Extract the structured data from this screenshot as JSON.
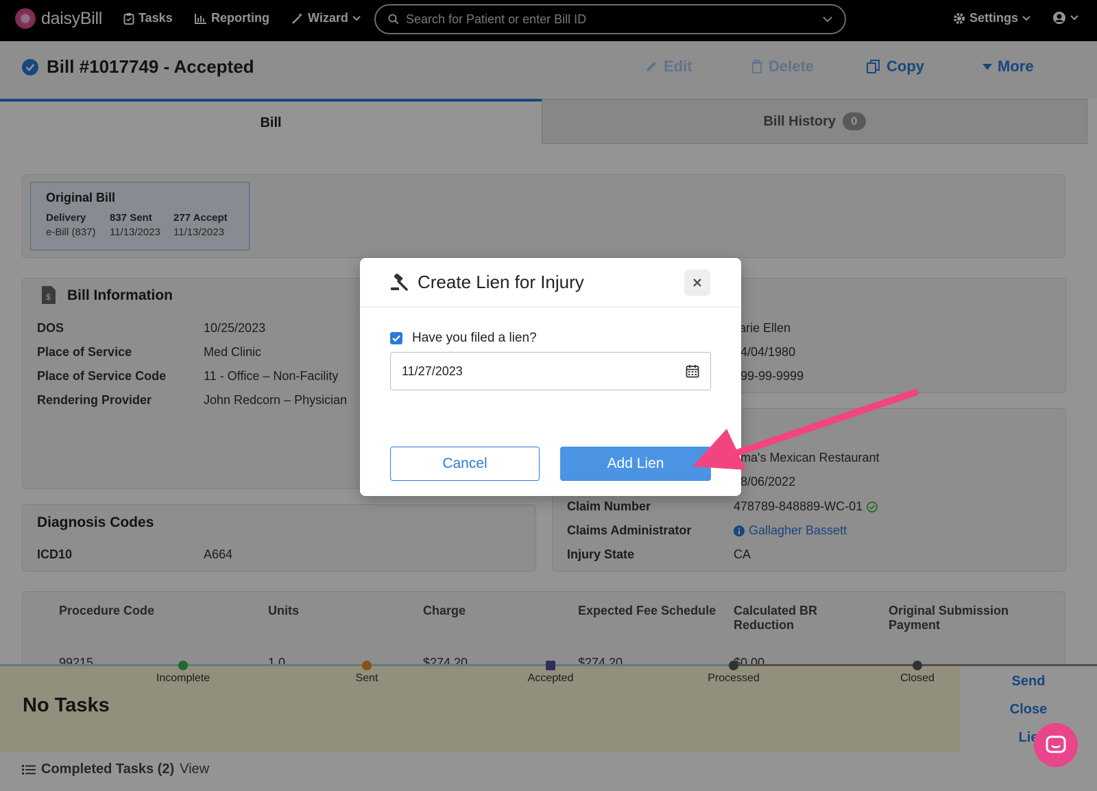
{
  "nav": {
    "brand": "daisyBill",
    "tasks": "Tasks",
    "reporting": "Reporting",
    "wizard": "Wizard",
    "search_placeholder": "Search for Patient or enter Bill ID",
    "settings": "Settings"
  },
  "header": {
    "title": "Bill #1017749 - Accepted",
    "edit": "Edit",
    "delete": "Delete",
    "copy": "Copy",
    "more": "More"
  },
  "tabs": {
    "bill": "Bill",
    "history": "Bill History",
    "history_count": "0"
  },
  "original_bill": {
    "heading": "Original Bill",
    "cols": [
      {
        "label": "Delivery",
        "value": "e-Bill (837)"
      },
      {
        "label": "837 Sent",
        "value": "11/13/2023"
      },
      {
        "label": "277 Accept",
        "value": "11/13/2023"
      }
    ]
  },
  "bill_info": {
    "heading": "Bill Information",
    "rows": [
      {
        "label": "DOS",
        "value": "10/25/2023"
      },
      {
        "label": "Place of Service",
        "value": "Med Clinic"
      },
      {
        "label": "Place of Service Code",
        "value": "11 - Office – Non-Facility"
      },
      {
        "label": "Rendering Provider",
        "value": "John Redcorn – Physician"
      }
    ]
  },
  "patient_partial": {
    "name": "larie Ellen",
    "dob": "4/04/1980",
    "ssn": "99-99-9999"
  },
  "claim": {
    "employer": "ma's Mexican Restaurant",
    "doi": "8/06/2022",
    "rows": [
      {
        "label": "Claim Number",
        "value": "478789-848889-WC-01"
      },
      {
        "label": "Claims Administrator",
        "value": "Gallagher Bassett"
      },
      {
        "label": "Injury State",
        "value": "CA"
      }
    ]
  },
  "diagnosis": {
    "heading": "Diagnosis Codes",
    "label": "ICD10",
    "value": "A664"
  },
  "procedure_table": {
    "headers": [
      "Procedure Code",
      "Units",
      "Charge",
      "Expected Fee Schedule",
      "Calculated BR Reduction",
      "Original Submission Payment"
    ],
    "row": [
      "99215",
      "1.0",
      "$274.20",
      "$274.20",
      "$0.00"
    ]
  },
  "statuses": [
    "Incomplete",
    "Sent",
    "Accepted",
    "Processed",
    "Closed"
  ],
  "tasks": {
    "none": "No Tasks",
    "completed": "Completed Tasks (2)",
    "view": "View"
  },
  "side_actions": [
    "Send",
    "Close",
    "Lie"
  ],
  "modal": {
    "title": "Create Lien for Injury",
    "checkbox_label": "Have you filed a lien?",
    "checked": true,
    "date_value": "11/27/2023",
    "cancel": "Cancel",
    "add": "Add Lien"
  },
  "colors": {
    "accent": "#2a7bd8",
    "annotation_arrow": "#f2457f",
    "brand_pink": "#e8458b"
  }
}
